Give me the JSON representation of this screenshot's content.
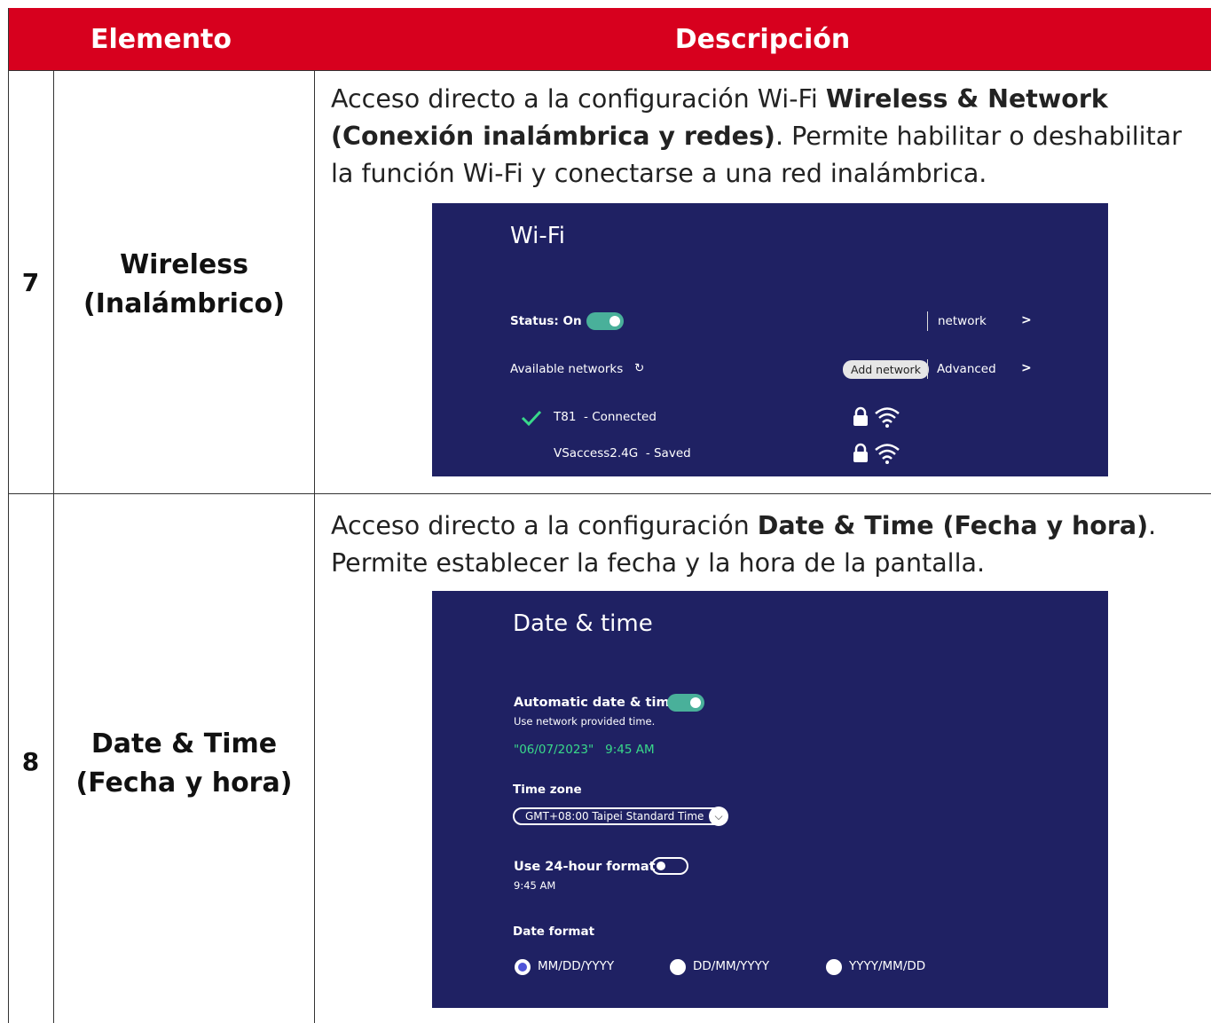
{
  "header": {
    "col1": "Elemento",
    "col2": "Descripción"
  },
  "rows": [
    {
      "number": "7",
      "element_line1": "Wireless",
      "element_line2": "(Inalámbrico)",
      "desc_before": "Acceso directo a la configuración Wi-Fi ",
      "desc_bold": "Wireless & Network (Conexión inalámbrica y redes)",
      "desc_after": ". Permite habilitar o deshabilitar la función Wi-Fi y conectarse a una red inalámbrica."
    },
    {
      "number": "8",
      "element_line1": "Date & Time",
      "element_line2": "(Fecha y hora)",
      "desc_before": "Acceso directo a la configuración ",
      "desc_bold": "Date & Time (Fecha y hora)",
      "desc_after": ". Permite establecer la fecha y la hora de la pantalla."
    }
  ],
  "wifi": {
    "title": "Wi-Fi",
    "status_label": "Status: On",
    "status_on": true,
    "network_link": "network",
    "available_label": "Available networks",
    "add_network": "Add network",
    "advanced": "Advanced",
    "networks": [
      {
        "name": "T81",
        "state": "- Connected",
        "connected": true
      },
      {
        "name": "VSaccess2.4G",
        "state": "- Saved",
        "connected": false
      }
    ]
  },
  "datetime": {
    "title": "Date & time",
    "auto_label": "Automatic date & time",
    "auto_sub": "Use network provided time.",
    "auto_on": true,
    "current_date": "\"06/07/2023\"",
    "current_time": "9:45 AM",
    "timezone_label": "Time zone",
    "timezone_value": "GMT+08:00 Taipei Standard Time",
    "hour24_label": "Use 24-hour format",
    "hour24_sub": "9:45 AM",
    "hour24_on": false,
    "date_format_label": "Date format",
    "formats": [
      "MM/DD/YYYY",
      "DD/MM/YYYY",
      "YYYY/MM/DD"
    ],
    "selected_format": "MM/DD/YYYY"
  },
  "colors": {
    "header_red": "#d7001e",
    "screen_bg": "#1f2163",
    "toggle_on": "#49b09a",
    "accent_green": "#39d98a",
    "radio_selected": "#4f54d8"
  }
}
